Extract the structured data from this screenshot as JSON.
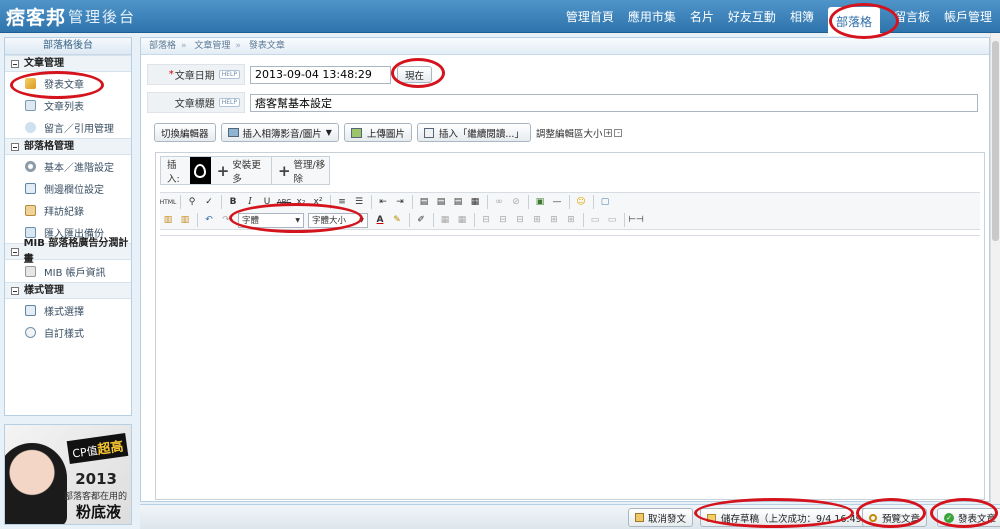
{
  "header": {
    "logo_text": "痞客邦",
    "admin_title": "管理後台",
    "nav": [
      {
        "label": "管理首頁"
      },
      {
        "label": "應用市集"
      },
      {
        "label": "名片"
      },
      {
        "label": "好友互動"
      },
      {
        "label": "相簿"
      },
      {
        "label": "部落格",
        "active": true
      },
      {
        "label": "留言板"
      },
      {
        "label": "帳戶管理"
      }
    ]
  },
  "sidebar": {
    "title": "部落格後台",
    "sections": [
      {
        "label": "文章管理",
        "items": [
          {
            "label": "發表文章",
            "icon": "pencil-icon"
          },
          {
            "label": "文章列表",
            "icon": "document-list-icon"
          },
          {
            "label": "留言／引用管理",
            "icon": "comment-icon"
          }
        ]
      },
      {
        "label": "部落格管理",
        "items": [
          {
            "label": "基本／進階設定",
            "icon": "gear-icon"
          },
          {
            "label": "側邊欄位設定",
            "icon": "sidebar-icon"
          },
          {
            "label": "拜訪紀錄",
            "icon": "visit-log-icon"
          },
          {
            "label": "匯入匯出備份",
            "icon": "backup-icon"
          }
        ]
      },
      {
        "label": "MIB 部落格廣告分潤計畫",
        "items": [
          {
            "label": "MIB 帳戶資訊",
            "icon": "account-icon"
          }
        ]
      },
      {
        "label": "樣式管理",
        "items": [
          {
            "label": "樣式選擇",
            "icon": "style-icon"
          },
          {
            "label": "自訂樣式",
            "icon": "custom-style-icon"
          }
        ]
      }
    ]
  },
  "ad": {
    "cp": "CP值",
    "cp_bold": "超高",
    "year": "2013",
    "line1": "部落客都在用的",
    "line2": "粉底液"
  },
  "breadcrumb": [
    "部落格",
    "文章管理",
    "發表文章"
  ],
  "form": {
    "date_label": "文章日期",
    "help": "HELP",
    "date_value": "2013-09-04 13:48:29",
    "now_button": "現在",
    "title_label": "文章標題",
    "title_value": "痞客幫基本設定"
  },
  "toolbar": {
    "switch_editor": "切換編輯器",
    "insert_media": "插入相簿影音/圖片",
    "upload_image": "上傳圖片",
    "insert_more": "插入「繼續閱讀...」",
    "resize_label": "調整編輯區大小"
  },
  "insert_bar": {
    "label": "插入:",
    "install_more": "安裝更多",
    "manage": "管理/移除"
  },
  "editor": {
    "font_select": "字體",
    "size_select": "字體大小"
  },
  "bottom": {
    "cancel": "取消發文",
    "save_draft": "儲存草稿（上次成功：9/4 16:49）",
    "preview": "預覽文章",
    "publish": "發表文章"
  }
}
